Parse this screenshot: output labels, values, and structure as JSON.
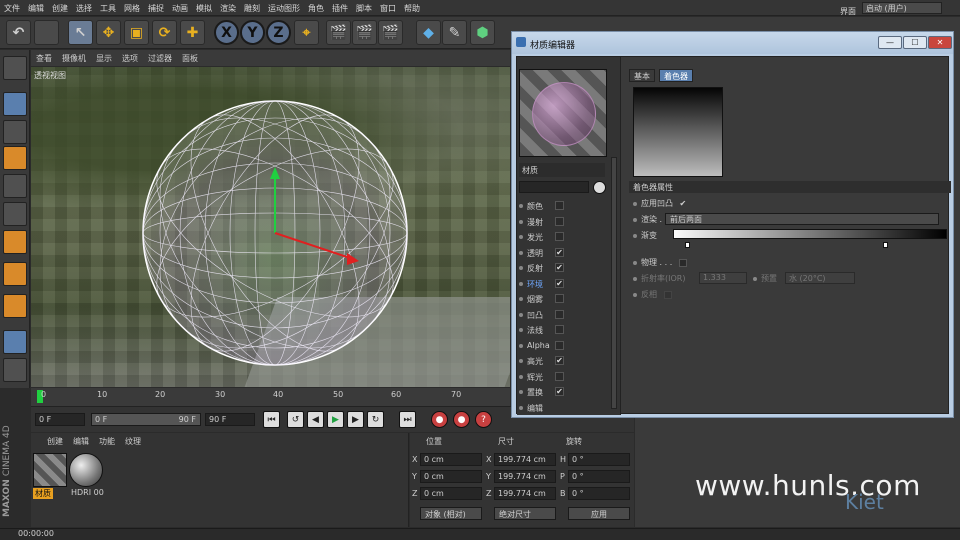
{
  "menubar": {
    "items": [
      "文件",
      "编辑",
      "创建",
      "选择",
      "工具",
      "网格",
      "捕捉",
      "动画",
      "模拟",
      "渲染",
      "雕刻",
      "运动图形",
      "角色",
      "插件",
      "脚本",
      "窗口",
      "帮助"
    ],
    "layout_label": "界面",
    "layout_value": "启动 (用户)"
  },
  "toolbar": {
    "axis_x": "X",
    "axis_y": "Y",
    "axis_z": "Z"
  },
  "viewport": {
    "menu": [
      "查看",
      "摄像机",
      "显示",
      "选项",
      "过滤器",
      "面板"
    ],
    "label": "透视视图"
  },
  "timeline": {
    "ticks": [
      "0",
      "10",
      "20",
      "30",
      "40",
      "50",
      "60",
      "70"
    ],
    "current_frame": "0 F",
    "start_field": "0 F",
    "range_end": "90 F",
    "end_field": "90 F"
  },
  "material_manager": {
    "menu": [
      "创建",
      "编辑",
      "功能",
      "纹理"
    ],
    "materials": [
      {
        "name": "材质",
        "selected": true
      },
      {
        "name": "HDRI 00",
        "selected": false
      }
    ]
  },
  "coords": {
    "headers": [
      "位置",
      "尺寸",
      "旋转"
    ],
    "rows": [
      {
        "axis": "X",
        "pos": "0 cm",
        "size_axis": "X",
        "size": "199.774 cm",
        "rot_axis": "H",
        "rot": "0 °"
      },
      {
        "axis": "Y",
        "pos": "0 cm",
        "size_axis": "Y",
        "size": "199.774 cm",
        "rot_axis": "P",
        "rot": "0 °"
      },
      {
        "axis": "Z",
        "pos": "0 cm",
        "size_axis": "Z",
        "size": "199.774 cm",
        "rot_axis": "B",
        "rot": "0 °"
      }
    ],
    "mode_left": "对象 (相对)",
    "mode_right": "绝对尺寸",
    "apply": "应用"
  },
  "logo": {
    "brand": "MAXON",
    "product": "CINEMA 4D"
  },
  "status": {
    "text": "00:00:00"
  },
  "watermark": {
    "text": "www.hunls.com",
    "sub": "Kiet"
  },
  "material_editor": {
    "title": "材质编辑器",
    "material_name": "材质",
    "channels": [
      {
        "name": "颜色",
        "checked": false,
        "active": false
      },
      {
        "name": "漫射",
        "checked": false,
        "active": false
      },
      {
        "name": "发光",
        "checked": false,
        "active": false
      },
      {
        "name": "透明",
        "checked": true,
        "active": false
      },
      {
        "name": "反射",
        "checked": true,
        "active": false
      },
      {
        "name": "环境",
        "checked": true,
        "active": true
      },
      {
        "name": "烟雾",
        "checked": false,
        "active": false
      },
      {
        "name": "凹凸",
        "checked": false,
        "active": false
      },
      {
        "name": "法线",
        "checked": false,
        "active": false
      },
      {
        "name": "Alpha",
        "checked": false,
        "active": false
      },
      {
        "name": "高光",
        "checked": true,
        "active": false
      },
      {
        "name": "辉光",
        "checked": false,
        "active": false
      },
      {
        "name": "置换",
        "checked": true,
        "active": false
      },
      {
        "name": "编辑",
        "checked": false,
        "active": false
      }
    ],
    "tabs": [
      {
        "label": "基本",
        "on": false
      },
      {
        "label": "着色器",
        "on": true
      }
    ],
    "section_title": "着色器属性",
    "use_bump_label": "应用凹凸",
    "blend_label": "渲染 . . . .",
    "blend_value": "前后两面",
    "gradient_label": "渐变",
    "physical_label": "物理 . . .",
    "ior_label": "折射率(IOR)",
    "ior_value": "1.333",
    "preset_label": "预置",
    "preset_value": "水 (20°C)",
    "invert_label": "反相"
  }
}
